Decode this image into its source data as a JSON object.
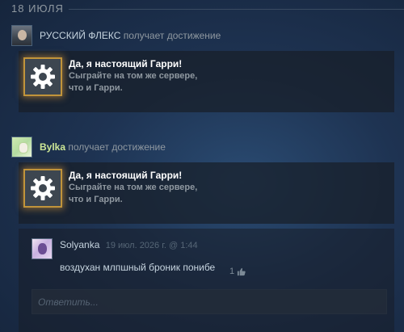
{
  "date_header": "18 ИЮЛЯ",
  "events": [
    {
      "user": "РУССКИЙ ФЛЕКС",
      "action": "получает достижение",
      "achievement": {
        "title": "Да, я настоящий Гарри!",
        "description": "Сыграйте на том же сервере, что и Гарри."
      }
    },
    {
      "user": "Bylka",
      "action": "получает достижение",
      "achievement": {
        "title": "Да, я настоящий Гарри!",
        "description": "Сыграйте на том же сервере, что и Гарри."
      }
    }
  ],
  "comment": {
    "author": "Solyanka",
    "time": "19 июл. 2026 г. @ 1:44",
    "text": "воздухан млпшный броник понибе",
    "likes": "1"
  },
  "reply": {
    "placeholder": "Ответить..."
  },
  "colors": {
    "accent_green": "#cde796",
    "achievement_glow": "#c1943b"
  }
}
